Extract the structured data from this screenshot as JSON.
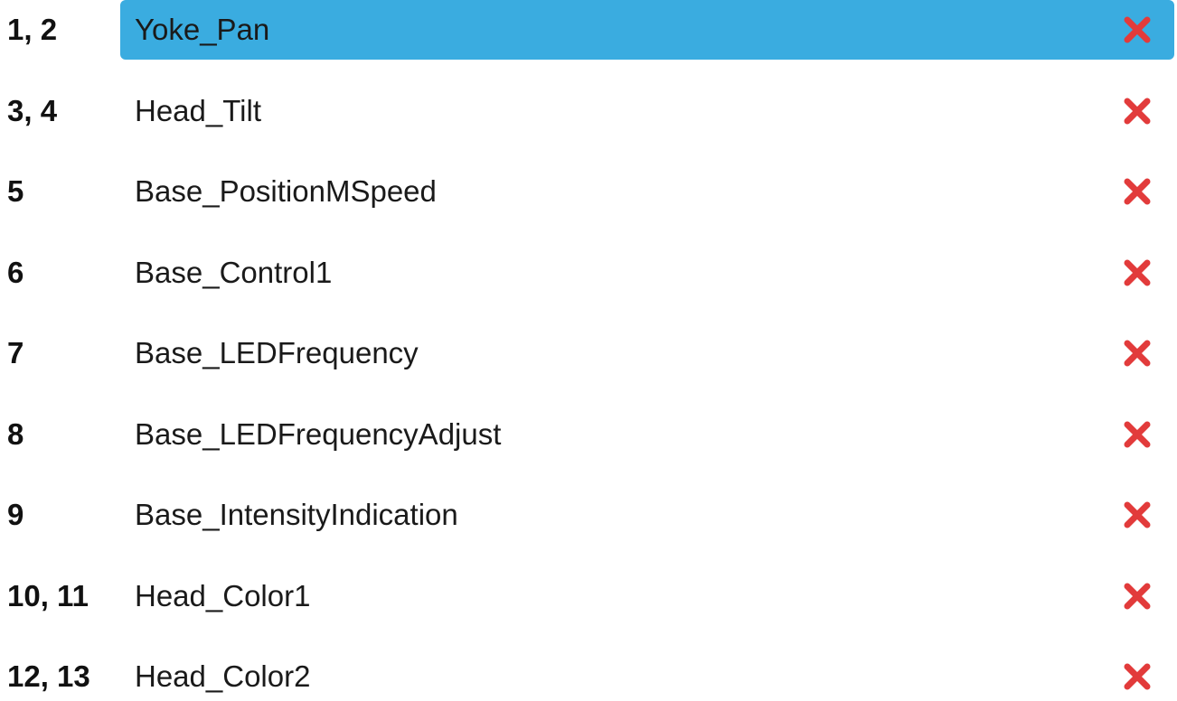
{
  "selected_index": 0,
  "colors": {
    "selection": "#3aace0",
    "delete_icon": "#e23b3b",
    "text": "#1a1a1a"
  },
  "delete_icon": "close-icon",
  "rows": [
    {
      "channel": "1, 2",
      "name": "Yoke_Pan"
    },
    {
      "channel": "3, 4",
      "name": "Head_Tilt"
    },
    {
      "channel": "5",
      "name": "Base_PositionMSpeed"
    },
    {
      "channel": "6",
      "name": "Base_Control1"
    },
    {
      "channel": "7",
      "name": "Base_LEDFrequency"
    },
    {
      "channel": "8",
      "name": "Base_LEDFrequencyAdjust"
    },
    {
      "channel": "9",
      "name": "Base_IntensityIndication"
    },
    {
      "channel": "10, 11",
      "name": "Head_Color1"
    },
    {
      "channel": "12, 13",
      "name": "Head_Color2"
    }
  ]
}
